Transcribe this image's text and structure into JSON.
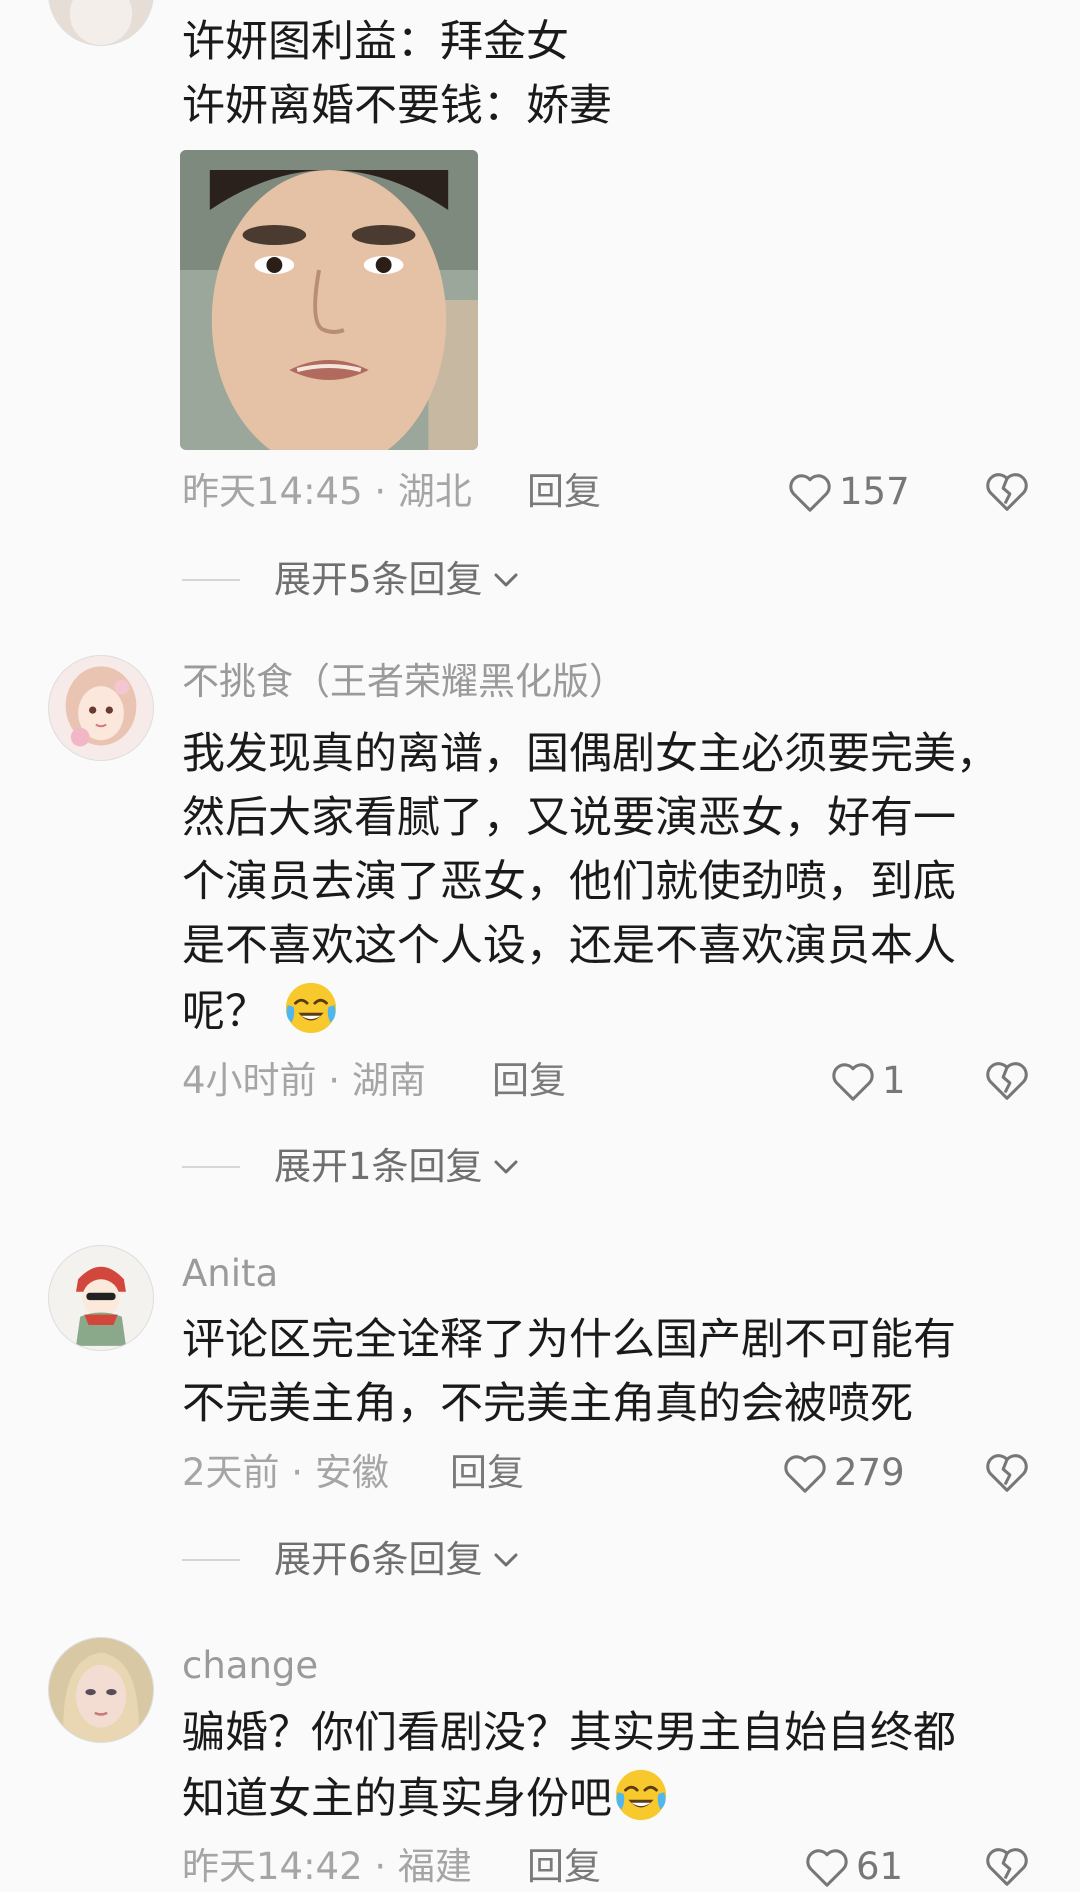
{
  "comments": [
    {
      "text_lines": [
        "许妍图利益：拜金女",
        "许妍离婚不要钱：娇妻"
      ],
      "time_location": "昨天14:45 · 湖北",
      "reply_label": "回复",
      "likes": "157",
      "expand_label": "展开5条回复"
    },
    {
      "username": "不挑食（王者荣耀黑化版）",
      "text_lines": [
        "我发现真的离谱，国偶剧女主必须要完美，",
        "然后大家看腻了，又说要演恶女，好有一",
        "个演员去演了恶女，他们就使劲喷，到底",
        "是不喜欢这个人设，还是不喜欢演员本人",
        "呢？"
      ],
      "time_location": "4小时前 · 湖南",
      "reply_label": "回复",
      "likes": "1",
      "expand_label": "展开1条回复"
    },
    {
      "username": "Anita",
      "text_lines": [
        "评论区完全诠释了为什么国产剧不可能有",
        "不完美主角，不完美主角真的会被喷死"
      ],
      "time_location": "2天前 · 安徽",
      "reply_label": "回复",
      "likes": "279",
      "expand_label": "展开6条回复"
    },
    {
      "username": "change",
      "text_lines": [
        "骗婚？你们看剧没？其实男主自始自终都",
        "知道女主的真实身份吧"
      ],
      "time_location": "昨天14:42 · 福建",
      "reply_label": "回复",
      "likes": "61"
    }
  ],
  "icons": {
    "like": "heart-outline-icon",
    "dislike": "broken-heart-icon",
    "expand": "chevron-down-icon",
    "emoji": "crying-laughing-emoji"
  },
  "colors": {
    "background": "#fafafa",
    "text": "#1a1a1a",
    "muted": "#a5a5a5"
  }
}
